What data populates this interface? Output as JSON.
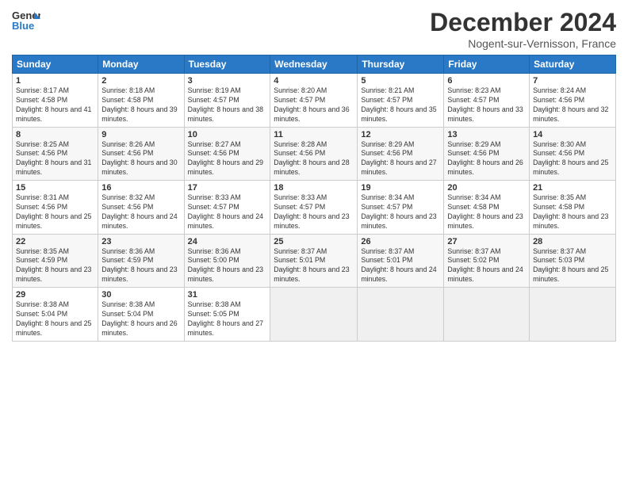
{
  "logo": {
    "text_general": "General",
    "text_blue": "Blue"
  },
  "title": "December 2024",
  "subtitle": "Nogent-sur-Vernisson, France",
  "days_header": [
    "Sunday",
    "Monday",
    "Tuesday",
    "Wednesday",
    "Thursday",
    "Friday",
    "Saturday"
  ],
  "weeks": [
    [
      {
        "num": "1",
        "rise": "8:17 AM",
        "set": "4:58 PM",
        "daylight": "8 hours and 41 minutes."
      },
      {
        "num": "2",
        "rise": "8:18 AM",
        "set": "4:58 PM",
        "daylight": "8 hours and 39 minutes."
      },
      {
        "num": "3",
        "rise": "8:19 AM",
        "set": "4:57 PM",
        "daylight": "8 hours and 38 minutes."
      },
      {
        "num": "4",
        "rise": "8:20 AM",
        "set": "4:57 PM",
        "daylight": "8 hours and 36 minutes."
      },
      {
        "num": "5",
        "rise": "8:21 AM",
        "set": "4:57 PM",
        "daylight": "8 hours and 35 minutes."
      },
      {
        "num": "6",
        "rise": "8:23 AM",
        "set": "4:57 PM",
        "daylight": "8 hours and 33 minutes."
      },
      {
        "num": "7",
        "rise": "8:24 AM",
        "set": "4:56 PM",
        "daylight": "8 hours and 32 minutes."
      }
    ],
    [
      {
        "num": "8",
        "rise": "8:25 AM",
        "set": "4:56 PM",
        "daylight": "8 hours and 31 minutes."
      },
      {
        "num": "9",
        "rise": "8:26 AM",
        "set": "4:56 PM",
        "daylight": "8 hours and 30 minutes."
      },
      {
        "num": "10",
        "rise": "8:27 AM",
        "set": "4:56 PM",
        "daylight": "8 hours and 29 minutes."
      },
      {
        "num": "11",
        "rise": "8:28 AM",
        "set": "4:56 PM",
        "daylight": "8 hours and 28 minutes."
      },
      {
        "num": "12",
        "rise": "8:29 AM",
        "set": "4:56 PM",
        "daylight": "8 hours and 27 minutes."
      },
      {
        "num": "13",
        "rise": "8:29 AM",
        "set": "4:56 PM",
        "daylight": "8 hours and 26 minutes."
      },
      {
        "num": "14",
        "rise": "8:30 AM",
        "set": "4:56 PM",
        "daylight": "8 hours and 25 minutes."
      }
    ],
    [
      {
        "num": "15",
        "rise": "8:31 AM",
        "set": "4:56 PM",
        "daylight": "8 hours and 25 minutes."
      },
      {
        "num": "16",
        "rise": "8:32 AM",
        "set": "4:56 PM",
        "daylight": "8 hours and 24 minutes."
      },
      {
        "num": "17",
        "rise": "8:33 AM",
        "set": "4:57 PM",
        "daylight": "8 hours and 24 minutes."
      },
      {
        "num": "18",
        "rise": "8:33 AM",
        "set": "4:57 PM",
        "daylight": "8 hours and 23 minutes."
      },
      {
        "num": "19",
        "rise": "8:34 AM",
        "set": "4:57 PM",
        "daylight": "8 hours and 23 minutes."
      },
      {
        "num": "20",
        "rise": "8:34 AM",
        "set": "4:58 PM",
        "daylight": "8 hours and 23 minutes."
      },
      {
        "num": "21",
        "rise": "8:35 AM",
        "set": "4:58 PM",
        "daylight": "8 hours and 23 minutes."
      }
    ],
    [
      {
        "num": "22",
        "rise": "8:35 AM",
        "set": "4:59 PM",
        "daylight": "8 hours and 23 minutes."
      },
      {
        "num": "23",
        "rise": "8:36 AM",
        "set": "4:59 PM",
        "daylight": "8 hours and 23 minutes."
      },
      {
        "num": "24",
        "rise": "8:36 AM",
        "set": "5:00 PM",
        "daylight": "8 hours and 23 minutes."
      },
      {
        "num": "25",
        "rise": "8:37 AM",
        "set": "5:01 PM",
        "daylight": "8 hours and 23 minutes."
      },
      {
        "num": "26",
        "rise": "8:37 AM",
        "set": "5:01 PM",
        "daylight": "8 hours and 24 minutes."
      },
      {
        "num": "27",
        "rise": "8:37 AM",
        "set": "5:02 PM",
        "daylight": "8 hours and 24 minutes."
      },
      {
        "num": "28",
        "rise": "8:37 AM",
        "set": "5:03 PM",
        "daylight": "8 hours and 25 minutes."
      }
    ],
    [
      {
        "num": "29",
        "rise": "8:38 AM",
        "set": "5:04 PM",
        "daylight": "8 hours and 25 minutes."
      },
      {
        "num": "30",
        "rise": "8:38 AM",
        "set": "5:04 PM",
        "daylight": "8 hours and 26 minutes."
      },
      {
        "num": "31",
        "rise": "8:38 AM",
        "set": "5:05 PM",
        "daylight": "8 hours and 27 minutes."
      },
      null,
      null,
      null,
      null
    ]
  ]
}
